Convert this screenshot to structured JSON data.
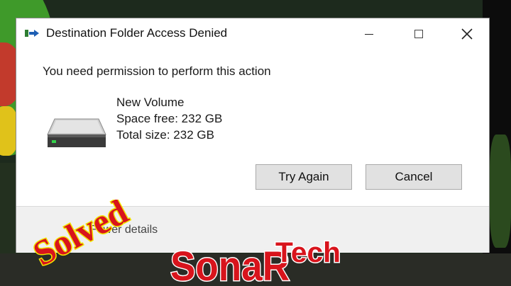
{
  "dialog": {
    "title": "Destination Folder Access Denied",
    "message": "You need permission to perform this action",
    "volume": {
      "name": "New Volume",
      "space_free": "Space free: 232 GB",
      "total_size": "Total size: 232 GB"
    },
    "buttons": {
      "try_again": "Try Again",
      "cancel": "Cancel"
    },
    "footer": {
      "details_toggle": "Fewer details"
    }
  },
  "watermarks": {
    "solved": "Solved",
    "brand_sonar": "SonaR",
    "brand_tech": "Tech"
  },
  "colors": {
    "dialog_bg": "#ffffff",
    "footer_bg": "#f0f0f0",
    "button_bg": "#e1e1e1",
    "stamp_red": "#d8141c",
    "stamp_yellow": "#f2e400"
  },
  "icons": {
    "app": "move-file-icon",
    "drive": "hard-drive-icon",
    "minimize": "minimize-icon",
    "maximize": "maximize-icon",
    "close": "close-icon"
  }
}
